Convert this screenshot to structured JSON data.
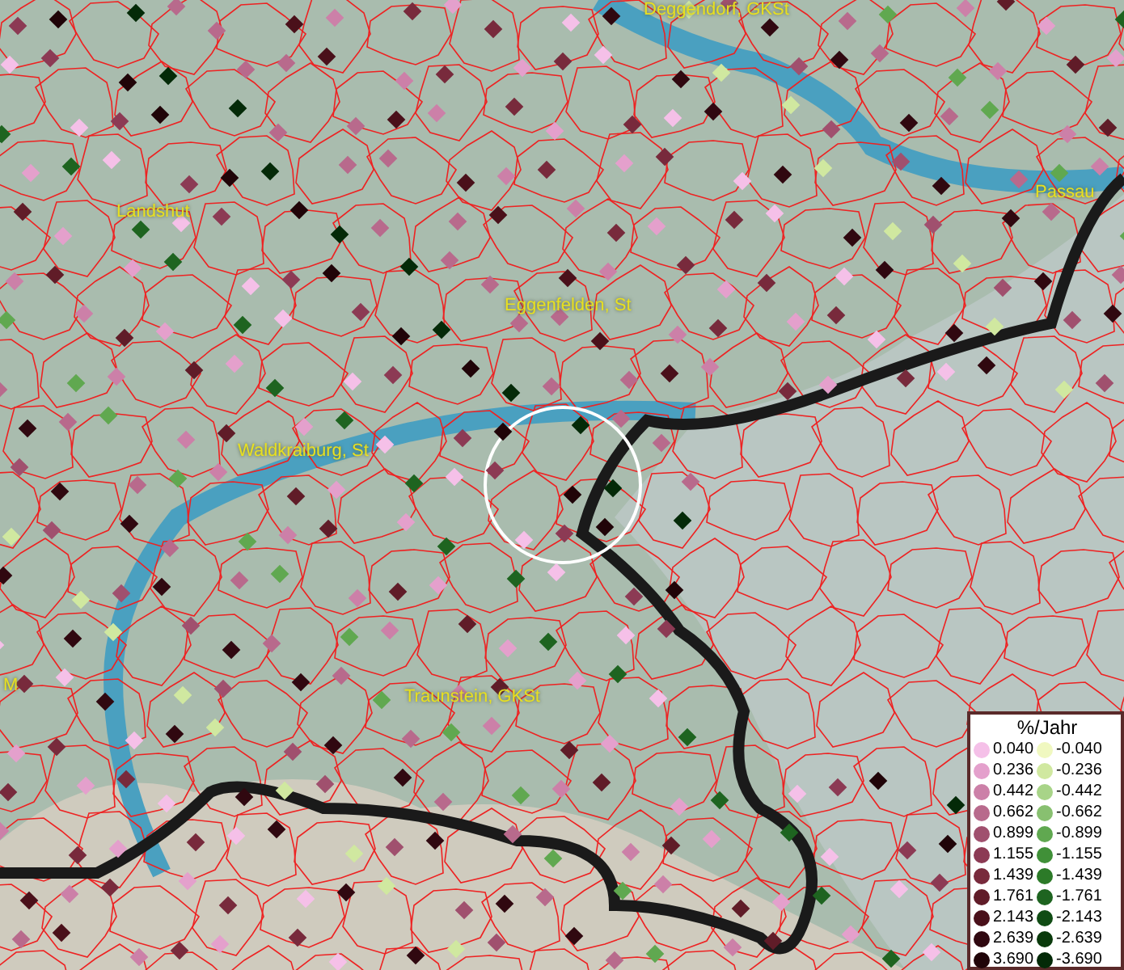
{
  "map": {
    "places": [
      {
        "name": "Deggendorf, GKSt"
      },
      {
        "name": "Landshut"
      },
      {
        "name": "Passau"
      },
      {
        "name": "Eggenfelden, St"
      },
      {
        "name": "Waldkraiburg, St"
      },
      {
        "name": "M"
      },
      {
        "name": "Traunstein, GKSt"
      }
    ]
  },
  "legend": {
    "title": "%/Jahr",
    "rows": [
      {
        "positive": {
          "value": "0.040",
          "color": "#f5c0e8"
        },
        "negative": {
          "value": "-0.040",
          "color": "#f0f8c0"
        }
      },
      {
        "positive": {
          "value": "0.236",
          "color": "#e4a0cc"
        },
        "negative": {
          "value": "-0.236",
          "color": "#d0e8a0"
        }
      },
      {
        "positive": {
          "value": "0.442",
          "color": "#cc80a8"
        },
        "negative": {
          "value": "-0.442",
          "color": "#a8d488"
        }
      },
      {
        "positive": {
          "value": "0.662",
          "color": "#b86a8c"
        },
        "negative": {
          "value": "-0.662",
          "color": "#88c070"
        }
      },
      {
        "positive": {
          "value": "0.899",
          "color": "#a0506e"
        },
        "negative": {
          "value": "-0.899",
          "color": "#60a850"
        }
      },
      {
        "positive": {
          "value": "1.155",
          "color": "#8c3a54"
        },
        "negative": {
          "value": "-1.155",
          "color": "#409038"
        }
      },
      {
        "positive": {
          "value": "1.439",
          "color": "#782a3c"
        },
        "negative": {
          "value": "-1.439",
          "color": "#2c7a28"
        }
      },
      {
        "positive": {
          "value": "1.761",
          "color": "#601c28"
        },
        "negative": {
          "value": "-1.761",
          "color": "#1e6420"
        }
      },
      {
        "positive": {
          "value": "2.143",
          "color": "#4a101a"
        },
        "negative": {
          "value": "-2.143",
          "color": "#104c14"
        }
      },
      {
        "positive": {
          "value": "2.639",
          "color": "#300810"
        },
        "negative": {
          "value": "-2.639",
          "color": "#0a3a0c"
        }
      },
      {
        "positive": {
          "value": "3.690",
          "color": "#200408"
        },
        "negative": {
          "value": "-3.690",
          "color": "#042a08"
        }
      }
    ]
  }
}
